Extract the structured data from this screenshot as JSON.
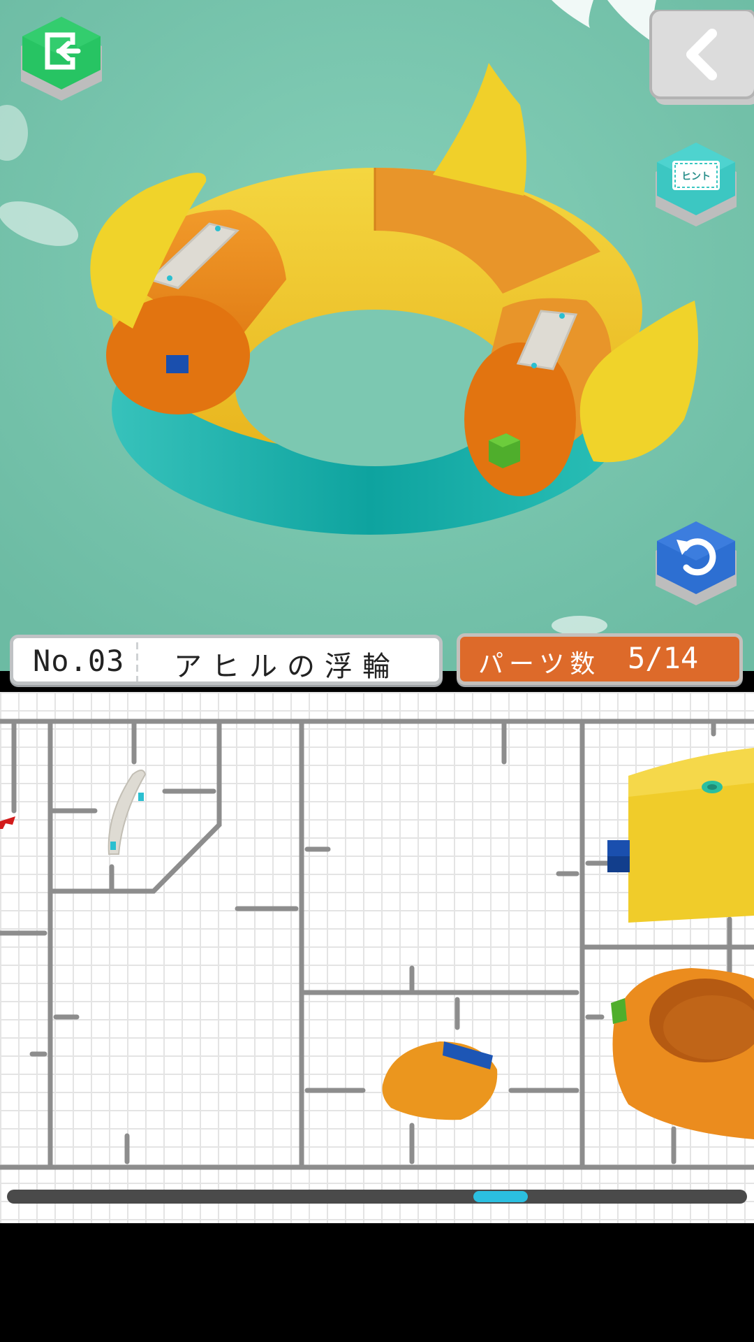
{
  "stage": {
    "number": "No.03",
    "name": "アヒルの浮輪"
  },
  "parts": {
    "label": "パーツ数",
    "count": "5/14"
  },
  "icons": {
    "exit": "exit-icon",
    "back": "chevron-left-icon",
    "hint": "hint-icon",
    "undo": "undo-icon"
  },
  "hint_label": "ヒント",
  "colors": {
    "background": "#7cc8b1",
    "exit_button": "#27c463",
    "hint_button": "#3cc7c2",
    "undo_button": "#2d6fd2",
    "parts_badge": "#dd6a2a",
    "scroll_thumb": "#2bbfe0"
  },
  "scroll": {
    "position": 0.68
  }
}
